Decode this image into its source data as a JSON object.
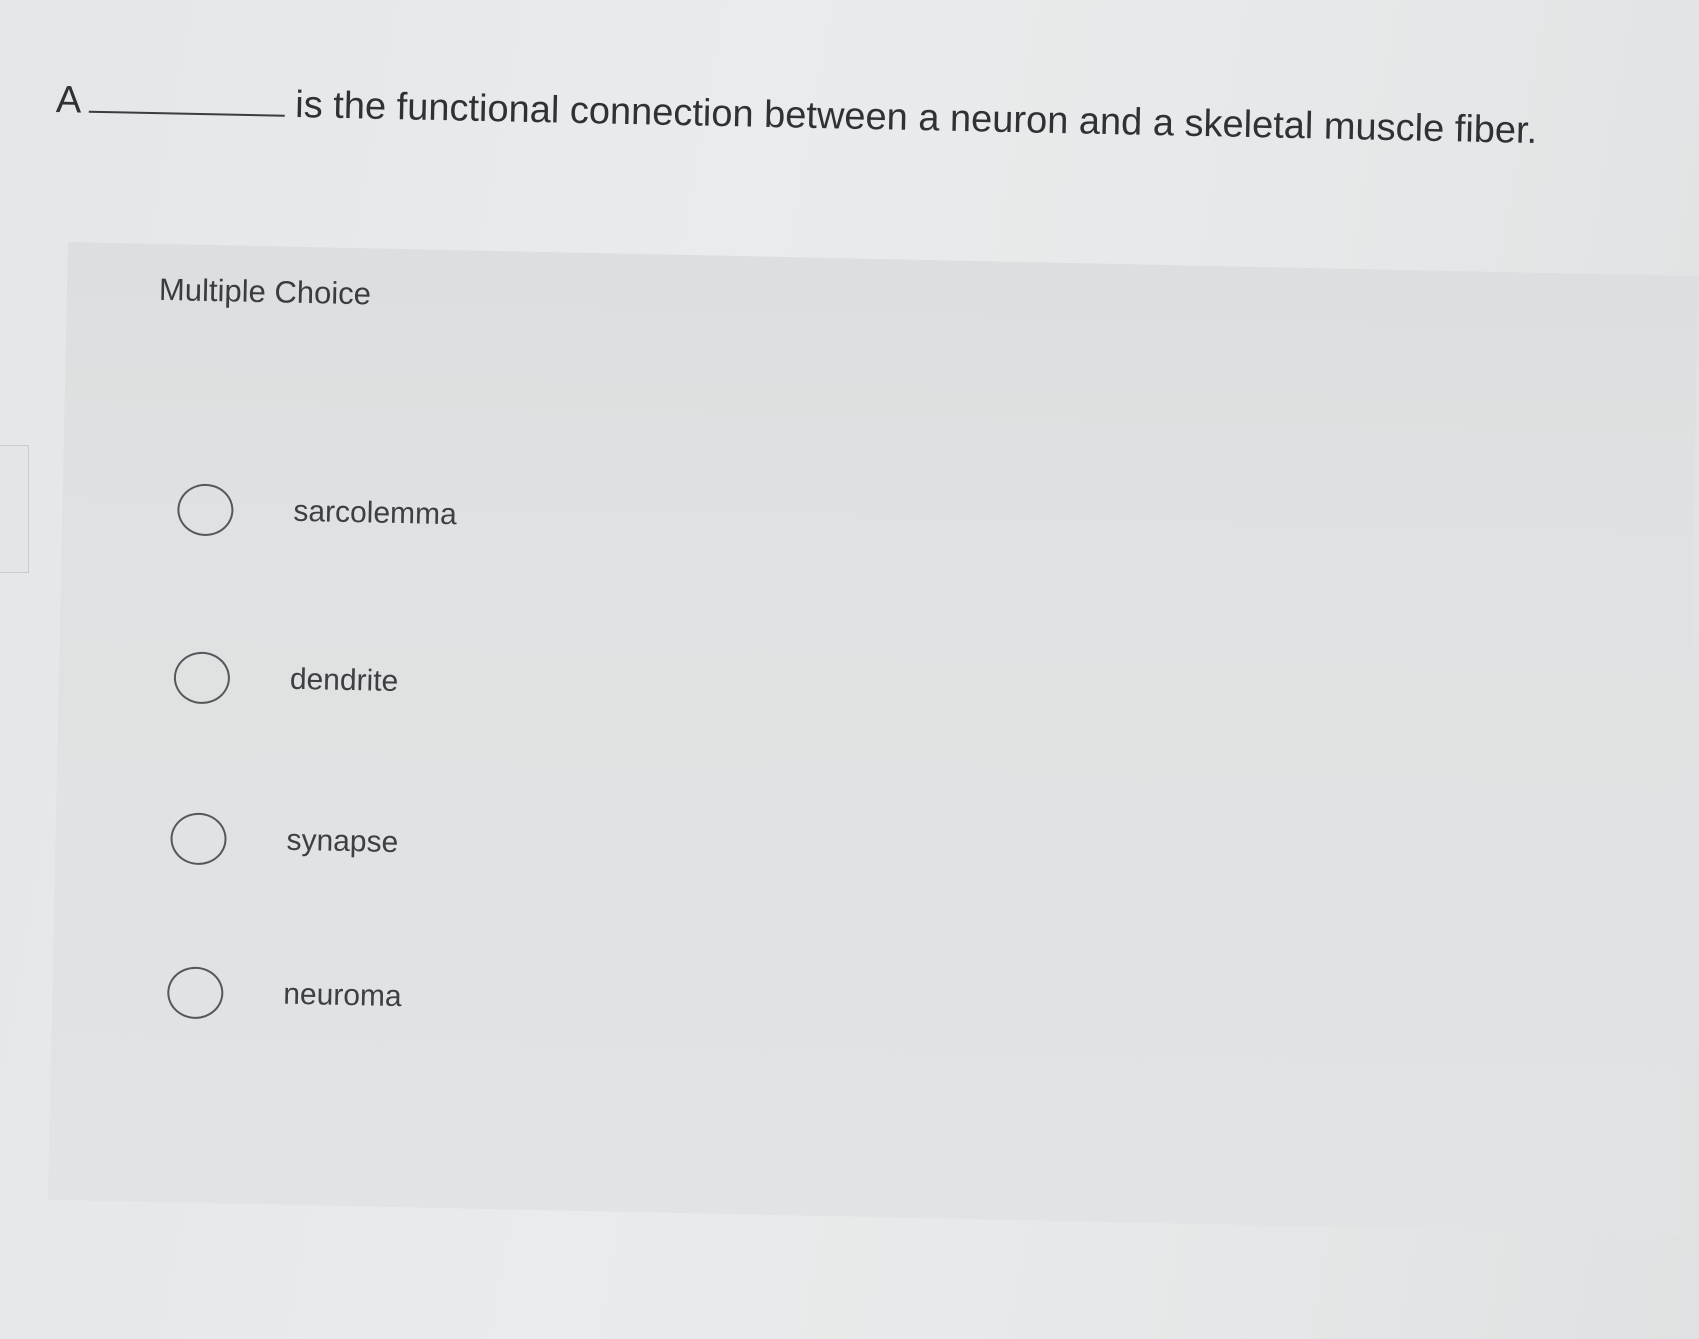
{
  "question": {
    "prefix": "A",
    "suffix": "is the functional connection between a neuron and a skeletal muscle fiber."
  },
  "card": {
    "label": "Multiple Choice",
    "options": [
      {
        "label": "sarcolemma",
        "selected": false
      },
      {
        "label": "dendrite",
        "selected": false
      },
      {
        "label": "synapse",
        "selected": false
      },
      {
        "label": "neuroma",
        "selected": false
      }
    ]
  }
}
